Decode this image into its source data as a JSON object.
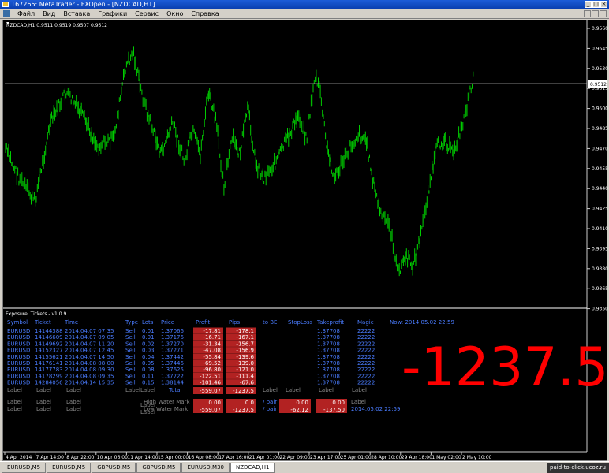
{
  "window": {
    "title": "167265: MetaTrader - FXOpen - [NZDCAD,H1]"
  },
  "menu": [
    "Файл",
    "Вид",
    "Вставка",
    "Графики",
    "Сервис",
    "Окно",
    "Справка"
  ],
  "chart": {
    "symbol_label": "NZDCAD,H1  0.9511 0.9519 0.9507 0.9512",
    "bid_price": "0.9512",
    "price_axis": [
      "0.9560",
      "0.9545",
      "0.9530",
      "0.9515",
      "0.9500",
      "0.9485",
      "0.9470",
      "0.9455",
      "0.9440",
      "0.9425",
      "0.9410",
      "0.9395",
      "0.9380",
      "0.9365",
      "0.9350"
    ],
    "time_axis": [
      "4 Apr 2014",
      "7 Apr 14:00",
      "8 Apr 22:00",
      "10 Apr 06:00",
      "11 Apr 14:00",
      "15 Apr 00:00",
      "16 Apr 08:00",
      "17 Apr 16:00",
      "21 Apr 01:00",
      "22 Apr 09:00",
      "23 Apr 17:00",
      "25 Apr 01:00",
      "28 Apr 10:00",
      "29 Apr 18:00",
      "1 May 02:00",
      "2 May 10:00"
    ],
    "up_color": "#00cc00",
    "bid_line_color": "#aaaaaa"
  },
  "indicator": {
    "name": "Exposure, Tickets - v1.0.9",
    "now_label": "Now: 2014.05.02 22:59",
    "headers": [
      "Symbol",
      "Ticket",
      "Time",
      "Type",
      "Lots",
      "Price",
      "Profit",
      "Pips",
      "to BE",
      "StopLoss",
      "Takeprofit",
      "Magic"
    ],
    "rows": [
      [
        "EURUSD",
        "14144388",
        "2014.04.07 07:35",
        "Sell",
        "0.01",
        "1.37066",
        "-17.81",
        "-178.1",
        "",
        "",
        "1.37708",
        "22222"
      ],
      [
        "EURUSD",
        "14146609",
        "2014.04.07 09:05",
        "Sell",
        "0.01",
        "1.37176",
        "-16.71",
        "-167.1",
        "",
        "",
        "1.37708",
        "22222"
      ],
      [
        "EURUSD",
        "14149692",
        "2014.04.07 11:20",
        "Sell",
        "0.02",
        "1.37270",
        "-31.34",
        "-156.7",
        "",
        "",
        "1.37708",
        "22222"
      ],
      [
        "EURUSD",
        "14152327",
        "2014.04.07 12:45",
        "Sell",
        "0.03",
        "1.37271",
        "-47.08",
        "-156.9",
        "",
        "",
        "1.37708",
        "22222"
      ],
      [
        "EURUSD",
        "14155621",
        "2014.04.07 14:50",
        "Sell",
        "0.04",
        "1.37442",
        "-55.84",
        "-139.6",
        "",
        "",
        "1.37708",
        "22222"
      ],
      [
        "EURUSD",
        "14176141",
        "2014.04.08 08:00",
        "Sell",
        "0.05",
        "1.37446",
        "-69.52",
        "-139.0",
        "",
        "",
        "1.37708",
        "22222"
      ],
      [
        "EURUSD",
        "14177783",
        "2014.04.08 09:30",
        "Sell",
        "0.08",
        "1.37625",
        "-96.80",
        "-121.0",
        "",
        "",
        "1.37708",
        "22222"
      ],
      [
        "EURUSD",
        "14178299",
        "2014.04.08 09:35",
        "Sell",
        "0.11",
        "1.37722",
        "-122.51",
        "-111.4",
        "",
        "",
        "1.37708",
        "22222"
      ],
      [
        "EURUSD",
        "14284056",
        "2014.04.14 15:35",
        "Sell",
        "0.15",
        "1.38144",
        "-101.46",
        "-67.6",
        "",
        "",
        "1.37708",
        "22222"
      ]
    ],
    "label_text": "Label",
    "total_label": "Total",
    "total_profit": "-559.07",
    "total_pips": "-1237.5",
    "water_mark_label_1": "High Water Mark",
    "water_mark_label_2": "Low Water Mark",
    "hwm_profit": "0.00",
    "hwm_pips": "0.0",
    "lwm_profit": "-559.07",
    "lwm_pips": "-1237.5",
    "per_pair_1": "/ pair",
    "per_pair_2": "/ pair",
    "pp_a": "0.00",
    "pp_b": "0.00",
    "pp_c": "-62.12",
    "pp_d": "-137.50",
    "lwm_time": "2014.05.02 22:59",
    "big_number": "-1237.5",
    "big_color": "#ff0000"
  },
  "tabs": [
    "EURUSD,M5",
    "EURUSD,M5",
    "GBPUSD,M5",
    "GBPUSD,M5",
    "EURUSD,M30",
    "NZDCAD,H1"
  ],
  "active_tab": 5,
  "watermark": "paid-to-click.ucoz.ru"
}
